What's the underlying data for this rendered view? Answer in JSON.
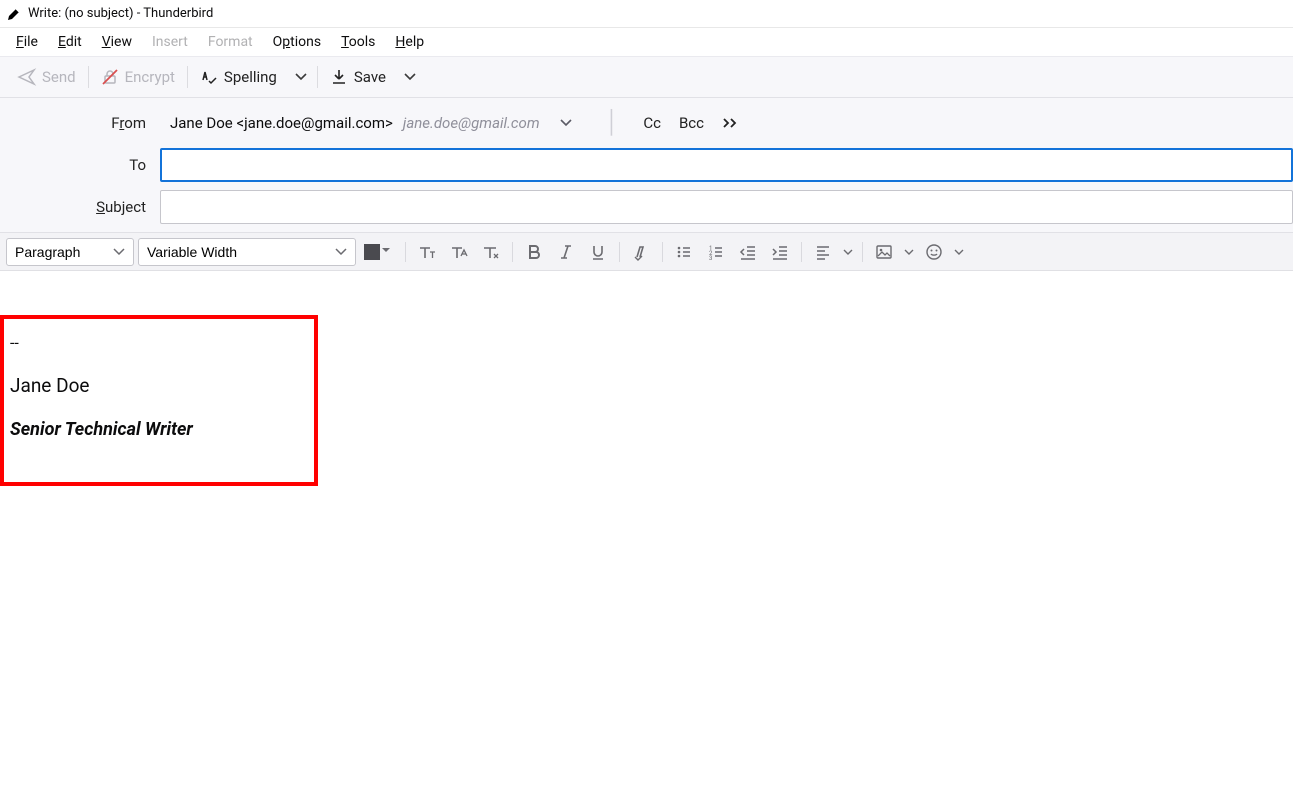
{
  "window": {
    "title": "Write: (no subject) - Thunderbird"
  },
  "menu": {
    "file": "File",
    "edit": "Edit",
    "view": "View",
    "insert": "Insert",
    "format": "Format",
    "options": "Options",
    "tools": "Tools",
    "help": "Help"
  },
  "toolbar": {
    "send": "Send",
    "encrypt": "Encrypt",
    "spelling": "Spelling",
    "save": "Save"
  },
  "addr": {
    "from_label": "From",
    "from_value": "Jane Doe <jane.doe@gmail.com>",
    "from_hint": "jane.doe@gmail.com",
    "to_label": "To",
    "to_value": "",
    "subject_label": "Subject",
    "subject_value": "",
    "cc": "Cc",
    "bcc": "Bcc"
  },
  "format": {
    "block_style": "Paragraph",
    "font_family": "Variable Width"
  },
  "signature": {
    "sep": "--",
    "name": "Jane Doe",
    "title": "Senior Technical Writer"
  }
}
